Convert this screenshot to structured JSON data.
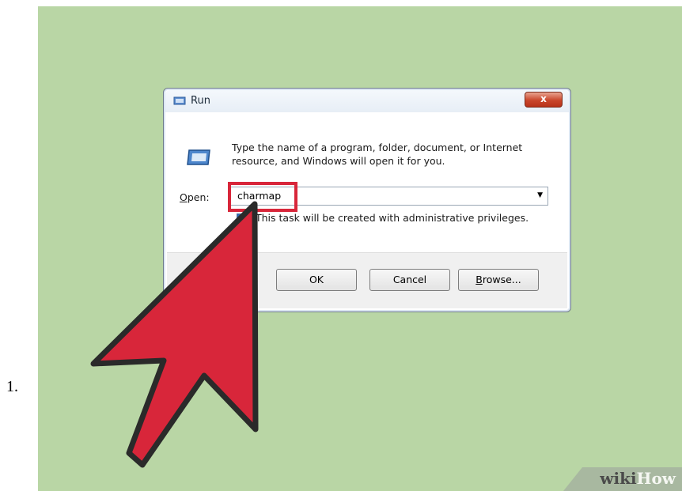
{
  "step": {
    "number": "1."
  },
  "dialog": {
    "title": "Run",
    "close_glyph": "x",
    "description": "Type the name of a program, folder, document, or Internet resource, and Windows will open it for you.",
    "open_label_underlined": "O",
    "open_label_rest": "pen:",
    "open_value": "charmap",
    "dropdown_glyph": "▼",
    "admin_text": "This task will be created with administrative privileges.",
    "buttons": {
      "ok": "OK",
      "cancel": "Cancel",
      "browse_underlined": "B",
      "browse_rest": "rowse..."
    }
  },
  "watermark": {
    "wiki": "wiki",
    "how": "How"
  },
  "icons": [
    "run-title-icon",
    "run-program-icon",
    "pointer-arrow-icon"
  ],
  "colors": {
    "background": "#b9d6a5",
    "highlight": "#d8263a",
    "arrow_fill": "#d8263a",
    "arrow_stroke": "#2a2a2a"
  }
}
